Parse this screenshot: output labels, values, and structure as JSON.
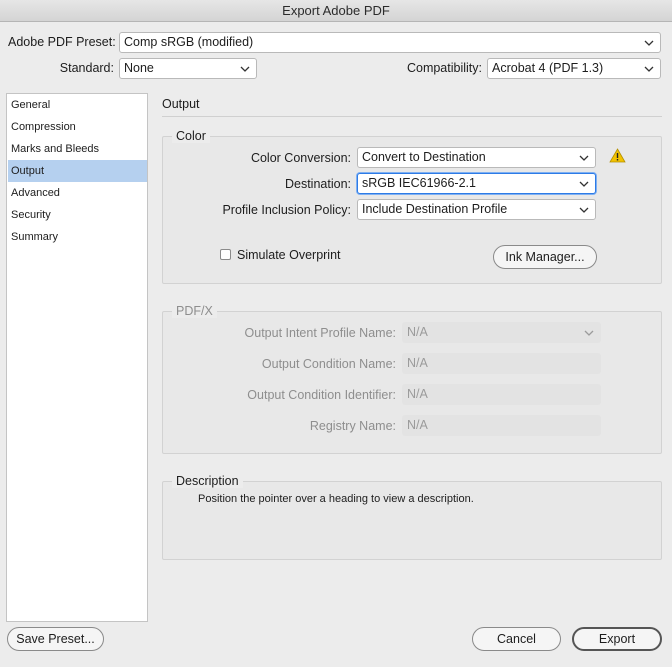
{
  "window": {
    "title": "Export Adobe PDF"
  },
  "top": {
    "preset_label": "Adobe PDF Preset:",
    "preset_value": "Comp sRGB (modified)",
    "standard_label": "Standard:",
    "standard_value": "None",
    "compatibility_label": "Compatibility:",
    "compatibility_value": "Acrobat 4 (PDF 1.3)"
  },
  "sidebar": {
    "items": [
      {
        "label": "General"
      },
      {
        "label": "Compression"
      },
      {
        "label": "Marks and Bleeds"
      },
      {
        "label": "Output"
      },
      {
        "label": "Advanced"
      },
      {
        "label": "Security"
      },
      {
        "label": "Summary"
      }
    ],
    "active": "Output"
  },
  "main": {
    "section_title": "Output",
    "color": {
      "title": "Color",
      "conversion_label": "Color Conversion:",
      "conversion_value": "Convert to Destination",
      "destination_label": "Destination:",
      "destination_value": "sRGB IEC61966-2.1",
      "profile_label": "Profile Inclusion Policy:",
      "profile_value": "Include Destination Profile",
      "simulate_overprint_label": "Simulate Overprint",
      "simulate_overprint_checked": false,
      "ink_manager_label": "Ink Manager..."
    },
    "pdfx": {
      "title": "PDF/X",
      "intent_label": "Output Intent Profile Name:",
      "intent_value": "N/A",
      "condition_name_label": "Output Condition Name:",
      "condition_name_value": "N/A",
      "condition_id_label": "Output Condition Identifier:",
      "condition_id_value": "N/A",
      "registry_label": "Registry Name:",
      "registry_value": "N/A"
    },
    "description": {
      "title": "Description",
      "text": "Position the pointer over a heading to view a description."
    }
  },
  "footer": {
    "save_preset_label": "Save Preset...",
    "cancel_label": "Cancel",
    "export_label": "Export"
  },
  "colors": {
    "accent": "#2d7be6",
    "selection": "#b5d0ef",
    "warning": "#f2c200"
  }
}
